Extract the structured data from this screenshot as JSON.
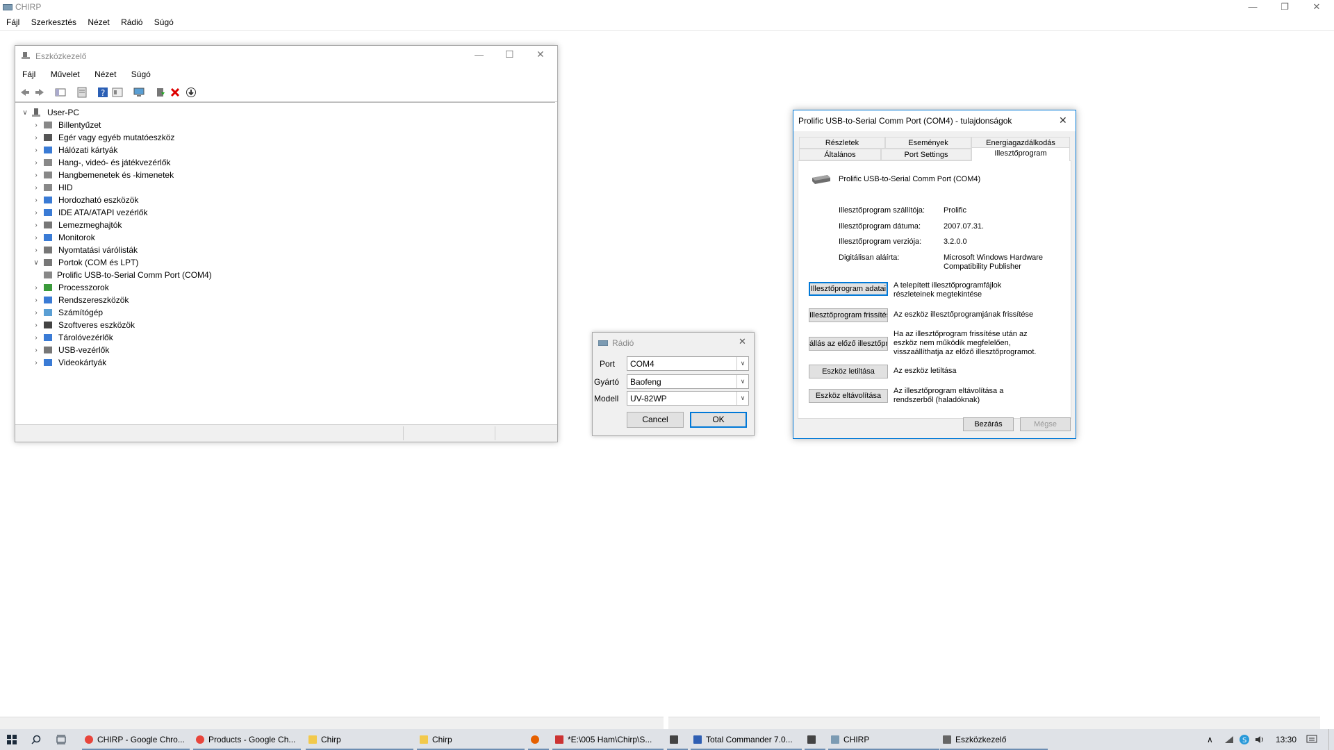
{
  "app": {
    "title": "CHIRP",
    "menu": [
      "Fájl",
      "Szerkesztés",
      "Nézet",
      "Rádió",
      "Súgó"
    ]
  },
  "device_manager": {
    "title": "Eszközkezelő",
    "menu": [
      "Fájl",
      "Művelet",
      "Nézet",
      "Súgó"
    ],
    "root": "User-PC",
    "nodes": [
      {
        "label": "Billentyűzet",
        "expanded": false
      },
      {
        "label": "Egér vagy egyéb mutatóeszköz",
        "expanded": false
      },
      {
        "label": "Hálózati kártyák",
        "expanded": false
      },
      {
        "label": "Hang-, videó- és játékvezérlők",
        "expanded": false
      },
      {
        "label": "Hangbemenetek és -kimenetek",
        "expanded": false
      },
      {
        "label": "HID",
        "expanded": false
      },
      {
        "label": "Hordozható eszközök",
        "expanded": false
      },
      {
        "label": "IDE ATA/ATAPI vezérlők",
        "expanded": false
      },
      {
        "label": "Lemezmeghajtók",
        "expanded": false
      },
      {
        "label": "Monitorok",
        "expanded": false
      },
      {
        "label": "Nyomtatási várólisták",
        "expanded": false
      },
      {
        "label": "Portok (COM és LPT)",
        "expanded": true
      },
      {
        "label": "Prolific USB-to-Serial Comm Port (COM4)",
        "child": true
      },
      {
        "label": "Processzorok",
        "expanded": false
      },
      {
        "label": "Rendszereszközök",
        "expanded": false
      },
      {
        "label": "Számítógép",
        "expanded": false
      },
      {
        "label": "Szoftveres eszközök",
        "expanded": false
      },
      {
        "label": "Tárolóvezérlők",
        "expanded": false
      },
      {
        "label": "USB-vezérlők",
        "expanded": false
      },
      {
        "label": "Videokártyák",
        "expanded": false
      }
    ]
  },
  "radio_dialog": {
    "title": "Rádió",
    "port_label": "Port",
    "port_value": "COM4",
    "vendor_label": "Gyártó",
    "vendor_value": "Baofeng",
    "model_label": "Modell",
    "model_value": "UV-82WP",
    "cancel": "Cancel",
    "ok": "OK"
  },
  "properties_dialog": {
    "title": "Prolific USB-to-Serial Comm Port (COM4) - tulajdonságok",
    "tabs_row1": [
      "Részletek",
      "Események",
      "Energiagazdálkodás"
    ],
    "tabs_row2": [
      "Általános",
      "Port Settings",
      "Illesztőprogram"
    ],
    "active_tab": "Illesztőprogram",
    "device_name": "Prolific USB-to-Serial Comm Port (COM4)",
    "fields": [
      {
        "key": "Illesztőprogram szállítója:",
        "value": "Prolific"
      },
      {
        "key": "Illesztőprogram dátuma:",
        "value": "2007.07.31."
      },
      {
        "key": "Illesztőprogram verziója:",
        "value": "3.2.0.0"
      },
      {
        "key": "Digitálisan aláírta:",
        "value": "Microsoft Windows Hardware Compatibility Publisher"
      }
    ],
    "actions": [
      {
        "button": "Illesztőprogram adatai",
        "desc": "A telepített illesztőprogramfájlok részleteinek megtekintése"
      },
      {
        "button": "Illesztőprogram frissítése",
        "desc": "Az eszköz illesztőprogramjának frissítése"
      },
      {
        "button": "állás az előző illesztőprog",
        "desc": "Ha az illesztőprogram frissítése után az eszköz nem működik megfelelően, visszaállíthatja az előző illesztőprogramot."
      },
      {
        "button": "Eszköz letiltása",
        "desc": "Az eszköz letiltása"
      },
      {
        "button": "Eszköz eltávolítása",
        "desc": "Az illesztőprogram eltávolítása a rendszerből (haladóknak)"
      }
    ],
    "close": "Bezárás",
    "cancel": "Mégse"
  },
  "taskbar": {
    "items": [
      {
        "label": "CHIRP - Google Chro...",
        "icon": "chrome-icon"
      },
      {
        "label": "Products - Google Ch...",
        "icon": "chrome-icon"
      },
      {
        "label": "Chirp",
        "icon": "folder-icon"
      },
      {
        "label": "Chirp",
        "icon": "folder-icon"
      },
      {
        "label": "",
        "icon": "firefox-icon"
      },
      {
        "label": "*E:\\005 Ham\\Chirp\\S...",
        "icon": "notepad-icon"
      },
      {
        "label": "",
        "icon": "app-icon"
      },
      {
        "label": "Total Commander 7.0...",
        "icon": "total-commander-icon"
      },
      {
        "label": "",
        "icon": "app-icon"
      },
      {
        "label": "CHIRP",
        "icon": "chirp-icon"
      },
      {
        "label": "Eszközkezelő",
        "icon": "device-manager-icon"
      }
    ],
    "time": "13:30"
  },
  "colors": {
    "accent": "#0078d7",
    "taskbar": "#dfe2e7"
  }
}
